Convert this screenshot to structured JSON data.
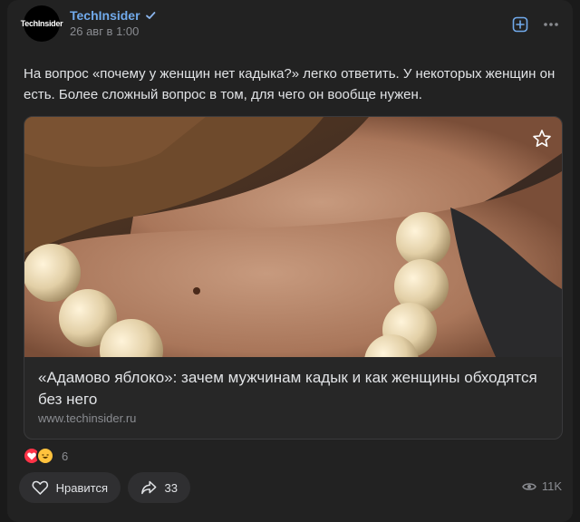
{
  "post": {
    "author": "TechInsider",
    "avatar_text": "TechInsider",
    "date": "26 авг в 1:00",
    "text": "На вопрос «почему у женщин нет кадыка?» легко ответить. У некоторых женщин он есть. Более сложный вопрос в том, для чего он вообще нужен."
  },
  "link_card": {
    "title": "«Адамово яблоко»: зачем мужчинам кадык и как женщины обходятся без него",
    "domain": "www.techinsider.ru",
    "image_icon": "photo-neck-beads"
  },
  "reactions": {
    "icons": [
      "heart-icon",
      "laugh-emoji-icon"
    ],
    "count": "6"
  },
  "actions": {
    "like_label": "Нравится",
    "share_count": "33",
    "views": "11K"
  },
  "colors": {
    "accent": "#71aaeb",
    "background": "#222222",
    "reaction_heart": "#ff3347"
  }
}
